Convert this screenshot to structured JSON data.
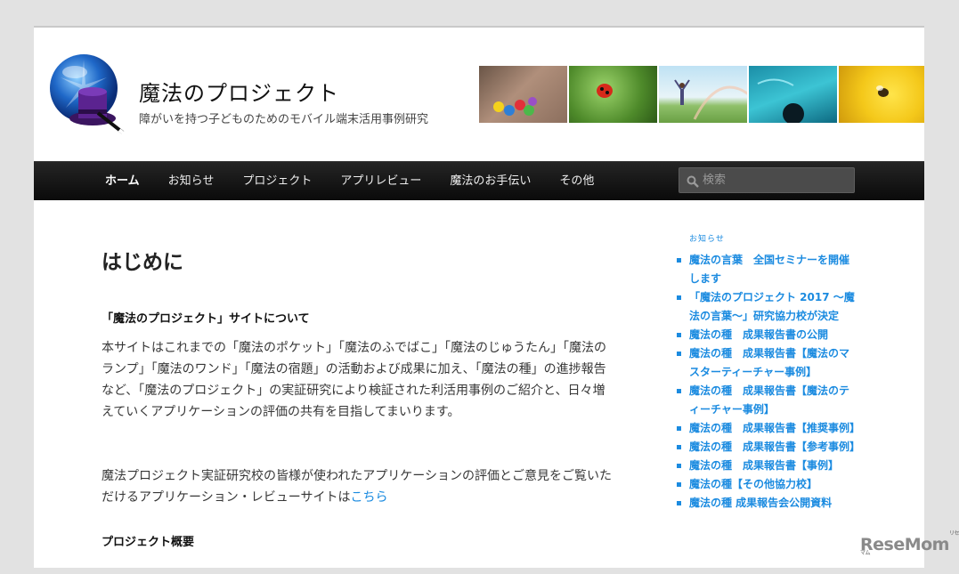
{
  "site": {
    "title": "魔法のプロジェクト",
    "description": "障がいを持つ子どものためのモバイル端末活用事例研究"
  },
  "header_images": [
    "hands-candies",
    "ladybug-leaf",
    "girl-rainbow",
    "aquarium",
    "bee-flower"
  ],
  "nav": {
    "items": [
      {
        "label": "ホーム",
        "active": true
      },
      {
        "label": "お知らせ",
        "active": false
      },
      {
        "label": "プロジェクト",
        "active": false
      },
      {
        "label": "アプリレビュー",
        "active": false
      },
      {
        "label": "魔法のお手伝い",
        "active": false
      },
      {
        "label": "その他",
        "active": false
      }
    ],
    "search_placeholder": "検索"
  },
  "main": {
    "title": "はじめに",
    "section1_heading": "「魔法のプロジェクト」サイトについて",
    "para1": "本サイトはこれまでの「魔法のポケット」「魔法のふでばこ」「魔法のじゅうたん」「魔法のランプ」「魔法のワンド」「魔法の宿題」の活動および成果に加え、「魔法の種」の進捗報告など、「魔法のプロジェクト」の実証研究により検証された利活用事例のご紹介と、日々増えていくアプリケーションの評価の共有を目指してまいります。",
    "para2_text": "魔法プロジェクト実証研究校の皆様が使われたアプリケーションの評価とご意見をご覧いただけるアプリケーション・レビューサイトは",
    "para2_link": "こちら",
    "section2_heading": "プロジェクト概要"
  },
  "sidebar": {
    "widget_title": "お知らせ",
    "news": [
      "魔法の言葉　全国セミナーを開催します",
      "「魔法のプロジェクト 2017 〜魔法の言葉〜」研究協力校が決定",
      "魔法の種　成果報告書の公開",
      "魔法の種　成果報告書【魔法のマスターティーチャー事例】",
      "魔法の種　成果報告書【魔法のティーチャー事例】",
      "魔法の種　成果報告書【推奨事例】",
      "魔法の種　成果報告書【参考事例】",
      "魔法の種　成果報告書【事例】",
      "魔法の種【その他協力校】",
      "魔法の種 成果報告会公開資料"
    ]
  },
  "watermark": {
    "text": "ReseMom",
    "sup": "リセマム"
  },
  "colors": {
    "accent": "#1b8be0",
    "nav_bg": "#111111",
    "page_bg": "#e2e2e2"
  }
}
